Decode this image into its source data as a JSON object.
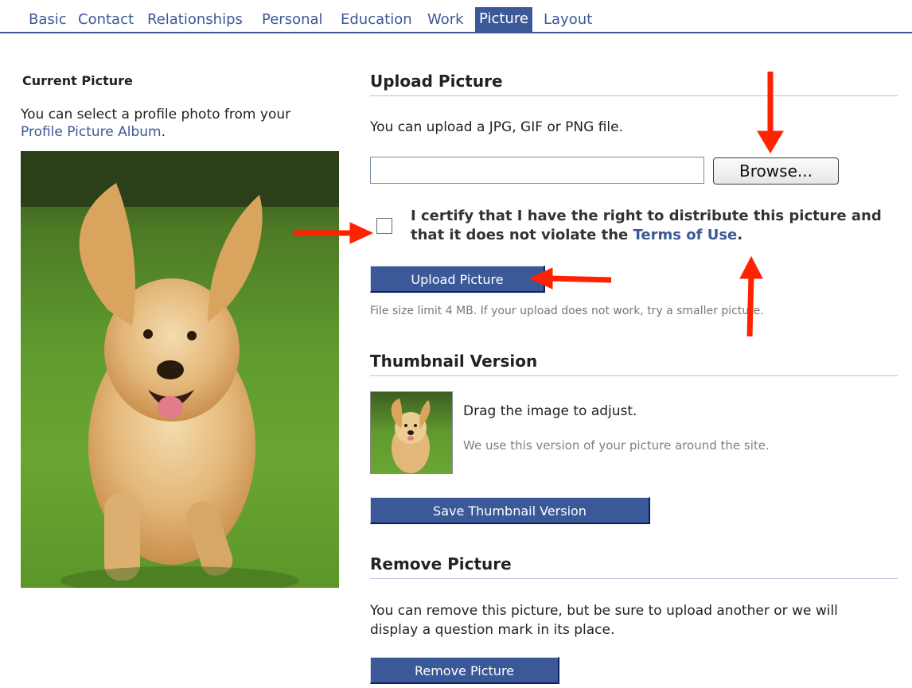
{
  "tabs": [
    {
      "label": "Basic"
    },
    {
      "label": "Contact"
    },
    {
      "label": "Relationships"
    },
    {
      "label": "Personal"
    },
    {
      "label": "Education"
    },
    {
      "label": "Work"
    },
    {
      "label": "Picture",
      "active": true
    },
    {
      "label": "Layout"
    }
  ],
  "current_picture": {
    "heading": "Current Picture",
    "intro": "You can select a profile photo from your",
    "album_link": "Profile Picture Album",
    "period": "."
  },
  "upload": {
    "heading": "Upload Picture",
    "file_types": "You can upload a JPG, GIF or PNG file.",
    "file_value": "",
    "browse_label": "Browse...",
    "certify_text": "I certify that I have the right to distribute this picture and that it does not violate the",
    "terms_link": "Terms of Use",
    "terms_period": ".",
    "certify_checked": false,
    "button_label": "Upload Picture",
    "size_note": "File size limit 4 MB. If your upload does not work, try a smaller picture."
  },
  "thumbnail": {
    "heading": "Thumbnail Version",
    "drag_text": "Drag the image to adjust.",
    "usage_text": "We use this version of your picture around the site.",
    "button_label": "Save Thumbnail Version"
  },
  "remove": {
    "heading": "Remove Picture",
    "line1": "You can remove this picture, but be sure to upload another or we will",
    "line2": "display a question mark in its place.",
    "button_label": "Remove Picture"
  },
  "colors": {
    "brand": "#3b5998",
    "annotation": "#ff2200"
  }
}
